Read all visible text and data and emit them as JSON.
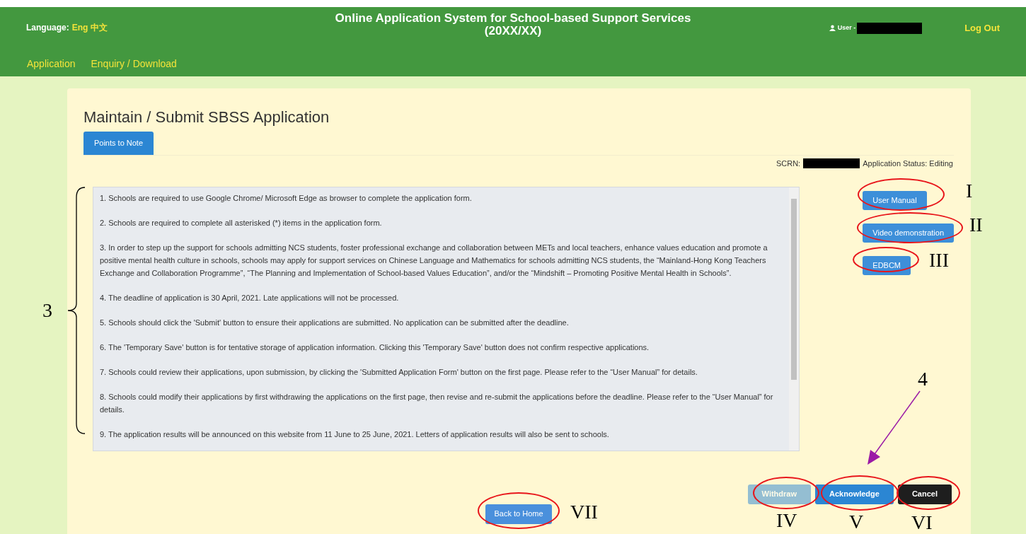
{
  "header": {
    "language_label": "Language:",
    "languages": [
      "Eng",
      "中文"
    ],
    "title_lines": [
      "Online Application System for School-based Support Services",
      "(20XX/XX)"
    ],
    "user_label": "User -",
    "logout": "Log Out"
  },
  "nav": [
    "Application",
    "Enquiry / Download"
  ],
  "page": {
    "title": "Maintain / Submit SBSS Application",
    "tabs": [
      {
        "label": "Points to Note",
        "selected": true
      }
    ],
    "scrn_label": "SCRN:",
    "status": "Application Status: Editing",
    "notes": [
      "1. Schools are required to use Google Chrome/ Microsoft Edge as browser to complete the application form.",
      "2. Schools are required to complete all asterisked (*) items in the application form.",
      "3. In order to step up the support for schools admitting NCS students, foster professional exchange and collaboration between METs and local teachers, enhance values education and promote a positive mental health culture in schools, schools may apply for support services on Chinese Language and Mathematics for schools admitting NCS students, the “Mainland-Hong Kong Teachers Exchange and Collaboration Programme”, “The Planning and Implementation of School-based Values Education”, and/or the “Mindshift – Promoting Positive Mental Health in Schools”.",
      "4. The deadline of application is 30 April, 2021. Late applications will not be processed.",
      "5. Schools should click the 'Submit' button to ensure their applications are submitted. No application can be submitted after the deadline.",
      "6. The 'Temporary Save' button is for tentative storage of application information. Clicking this 'Temporary Save' button does not confirm respective applications.",
      "7. Schools could review their applications, upon submission, by clicking the 'Submitted Application Form' button on the first page. Please refer to the “User Manual” for details.",
      "8. Schools could modify their applications by first withdrawing the applications on the first page, then revise and re-submit the applications before the deadline. Please refer to the “User Manual” for details.",
      "9. The application results will be announced on this website from 11 June to 25 June, 2021. Letters of application results will also be sent to schools."
    ],
    "side_buttons": [
      "User Manual",
      "Video demonstration",
      "EDBCM"
    ],
    "action_buttons": [
      {
        "label": "Withdraw",
        "kind": "secondary",
        "disabled": true
      },
      {
        "label": "Acknowledge",
        "kind": "primary",
        "disabled": false
      },
      {
        "label": "Cancel",
        "kind": "dark",
        "disabled": false
      }
    ],
    "back_button": "Back to Home"
  },
  "annotations": {
    "circled": [
      "I",
      "II",
      "III",
      "IV",
      "V",
      "VI",
      "VII"
    ],
    "bracket_label": "3",
    "arrow_label": "4"
  }
}
